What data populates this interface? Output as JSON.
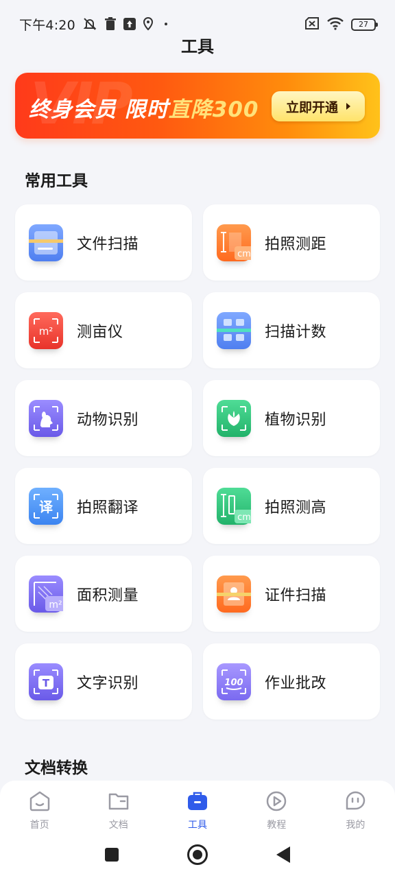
{
  "status_bar": {
    "time": "下午4:20",
    "battery": "27",
    "left_icons": [
      "mute-bell-icon",
      "trash-icon",
      "upload-icon",
      "location-icon",
      "dot-icon"
    ],
    "right_icons": [
      "sim-off-icon",
      "wifi-icon",
      "battery-icon"
    ]
  },
  "header": {
    "title": "工具"
  },
  "banner": {
    "watermark": "VIP",
    "slogan_part1": "终身会员 限时",
    "slogan_highlight": "直降300",
    "button_label": "立即开通",
    "gradient": [
      "#ff3a1a",
      "#ffc21a"
    ]
  },
  "sections": {
    "common_tools_title": "常用工具",
    "doc_convert_title": "文档转换"
  },
  "tools": [
    {
      "label": "文件扫描",
      "icon": "document-scan-icon",
      "color": "#5b8cf5"
    },
    {
      "label": "拍照测距",
      "icon": "ruler-cm-icon",
      "color": "#ff7a2e"
    },
    {
      "label": "测亩仪",
      "icon": "area-m2-icon",
      "color": "#f2493d"
    },
    {
      "label": "扫描计数",
      "icon": "count-scan-icon",
      "color": "#5b8cf5"
    },
    {
      "label": "动物识别",
      "icon": "animal-icon",
      "color": "#7b6cf0"
    },
    {
      "label": "植物识别",
      "icon": "plant-icon",
      "color": "#2fc07a"
    },
    {
      "label": "拍照翻译",
      "icon": "translate-icon",
      "color": "#4a90f5"
    },
    {
      "label": "拍照测高",
      "icon": "height-cm-icon",
      "color": "#2fc07a"
    },
    {
      "label": "面积测量",
      "icon": "area-measure-icon",
      "color": "#7b6cf0"
    },
    {
      "label": "证件扫描",
      "icon": "id-scan-icon",
      "color": "#ff7a2e"
    },
    {
      "label": "文字识别",
      "icon": "text-ocr-icon",
      "color": "#7b6cf0"
    },
    {
      "label": "作业批改",
      "icon": "homework-100-icon",
      "color": "#8b7cf2"
    }
  ],
  "icon_glyphs": {
    "translate": "译",
    "cm": "cm",
    "m2": "m²",
    "ocr": "T",
    "score": "100"
  },
  "bottom_nav": {
    "tabs": [
      {
        "label": "首页",
        "icon": "home-icon",
        "active": false
      },
      {
        "label": "文档",
        "icon": "folder-icon",
        "active": false
      },
      {
        "label": "工具",
        "icon": "toolbox-icon",
        "active": true
      },
      {
        "label": "教程",
        "icon": "play-icon",
        "active": false
      },
      {
        "label": "我的",
        "icon": "profile-icon",
        "active": false
      }
    ],
    "active_color": "#2f5bea",
    "inactive_color": "#9a9aa3"
  }
}
